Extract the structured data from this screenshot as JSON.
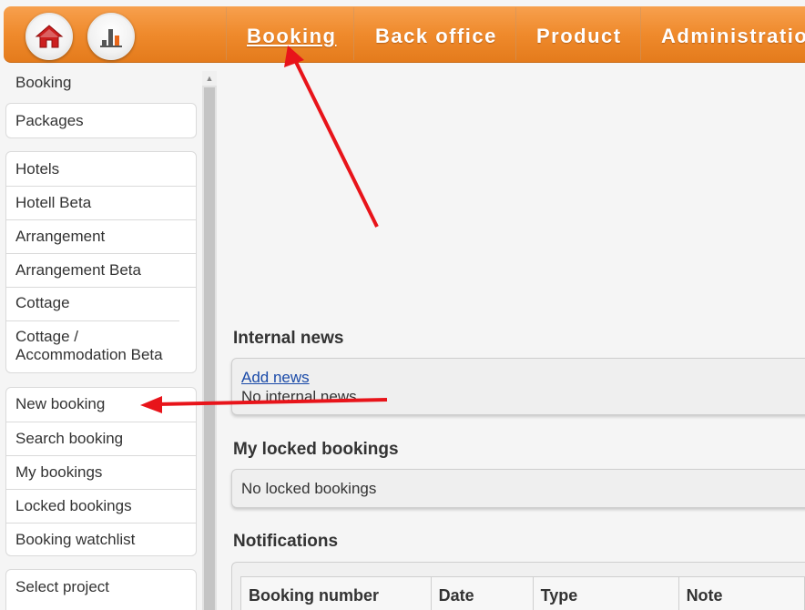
{
  "header": {
    "home_icon": "home-icon",
    "stats_icon": "bar-chart-icon",
    "nav": [
      {
        "label": "Booking",
        "active": true
      },
      {
        "label": "Back office"
      },
      {
        "label": "Product"
      },
      {
        "label": "Administration"
      }
    ]
  },
  "sidebar": {
    "heading": "Booking",
    "group1": [
      "Packages"
    ],
    "group2": [
      "Hotels",
      "Hotell Beta",
      "Arrangement",
      "Arrangement Beta",
      "Cottage",
      "Cottage / Accommodation Beta"
    ],
    "group3": [
      "New booking",
      "Search booking",
      "My bookings",
      "Locked bookings",
      "Booking watchlist"
    ],
    "group4": [
      "Select project"
    ]
  },
  "main": {
    "internal_news": {
      "title": "Internal news",
      "add_link": "Add news",
      "empty_text": "No internal news"
    },
    "locked_bookings": {
      "title": "My locked bookings",
      "empty_text": "No locked bookings"
    },
    "notifications": {
      "title": "Notifications",
      "columns": [
        "Booking number",
        "Date",
        "Type",
        "Note"
      ]
    }
  },
  "annotations": {
    "arrow_color": "#e8141a"
  }
}
